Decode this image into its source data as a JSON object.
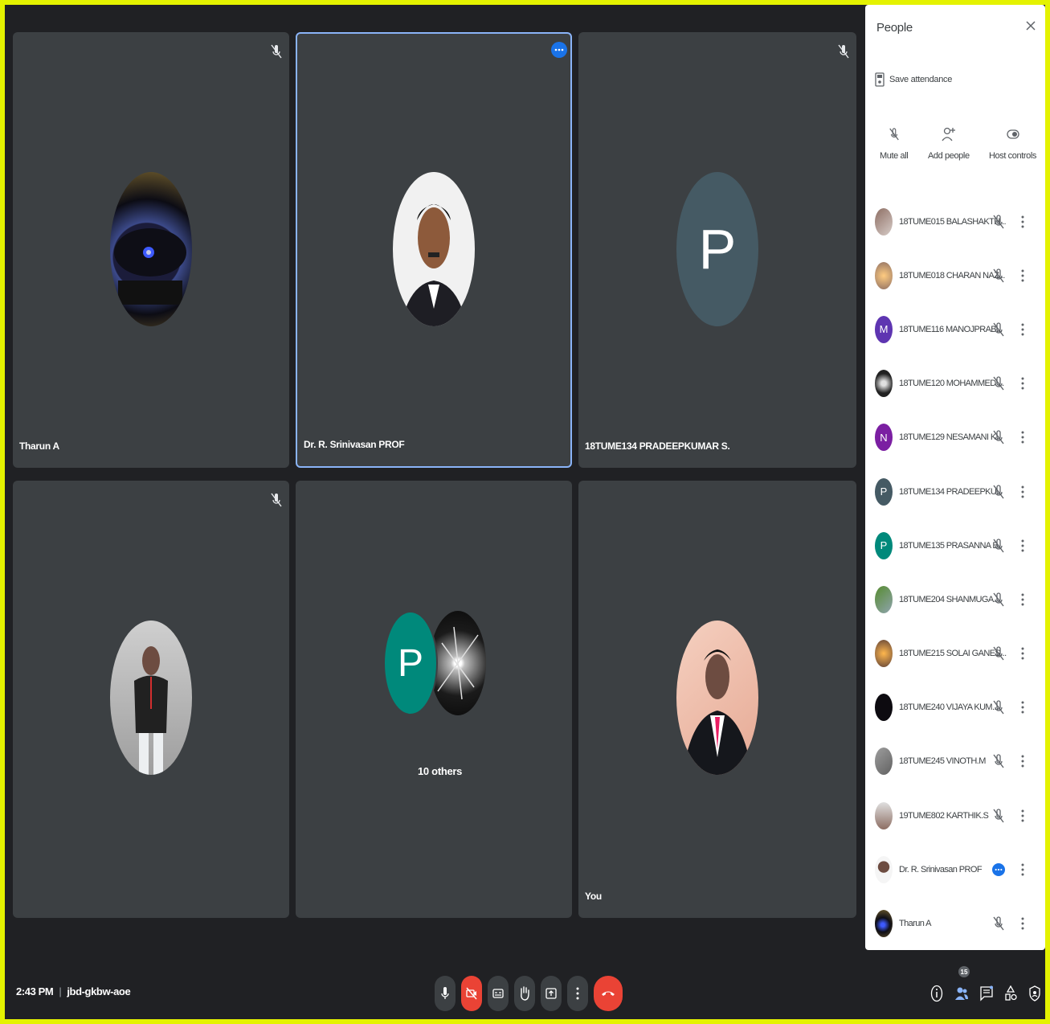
{
  "tiles": [
    {
      "name": "Tharun A",
      "muted": true
    },
    {
      "name": "Dr. R. Srinivasan PROF",
      "active": true
    },
    {
      "name": "18TUME134 PRADEEPKUMAR S.",
      "initial": "P",
      "avatar_color": "#455a64",
      "muted": true
    },
    {
      "name": "",
      "muted": true
    },
    {
      "others_label": "10 others",
      "initial": "P",
      "avatar_color": "#00897b"
    },
    {
      "name": "You"
    }
  ],
  "panel": {
    "title": "People",
    "save_attendance": "Save attendance",
    "actions": [
      "Mute all",
      "Add people",
      "Host controls"
    ],
    "participants": [
      {
        "name": "18TUME015 BALASHAKTH...",
        "status": "muted"
      },
      {
        "name": "18TUME018 CHARAN NAZ...",
        "status": "muted"
      },
      {
        "name": "18TUME116 MANOJPRAB...",
        "initial": "M",
        "color": "#5e35b1",
        "status": "muted"
      },
      {
        "name": "18TUME120 MOHAMMED ...",
        "status": "muted"
      },
      {
        "name": "18TUME129 NESAMANI K.",
        "initial": "N",
        "color": "#7b1fa2",
        "status": "muted"
      },
      {
        "name": "18TUME134 PRADEEPKU...",
        "initial": "P",
        "color": "#455a64",
        "status": "muted"
      },
      {
        "name": "18TUME135 PRASANNA B.",
        "initial": "P",
        "color": "#00897b",
        "status": "muted"
      },
      {
        "name": "18TUME204 SHANMUGA...",
        "status": "muted"
      },
      {
        "name": "18TUME215 SOLAI GANES...",
        "status": "muted"
      },
      {
        "name": "18TUME240 VIJAYA KUM...",
        "status": "muted"
      },
      {
        "name": "18TUME245 VINOTH.M",
        "status": "muted"
      },
      {
        "name": "19TUME802 KARTHIK.S",
        "status": "muted"
      },
      {
        "name": "Dr. R. Srinivasan PROF",
        "status": "speaking"
      },
      {
        "name": "Tharun A",
        "status": "muted"
      }
    ]
  },
  "bottom": {
    "time": "2:43 PM",
    "separator": "|",
    "meeting_code": "jbd-gkbw-aoe",
    "people_count": "15",
    "controls": [
      "mic-icon",
      "camera-off-icon",
      "captions-icon",
      "raise-hand-icon",
      "present-icon",
      "more-options-icon",
      "end-call-icon"
    ],
    "right_icons": [
      "info-icon",
      "people-icon",
      "chat-icon",
      "activities-icon",
      "host-controls-icon"
    ]
  },
  "colors": {
    "background": "#202124",
    "tile": "#3c4043",
    "accent": "#1a73e8",
    "danger": "#ea4335",
    "frame": "#e4f200"
  }
}
